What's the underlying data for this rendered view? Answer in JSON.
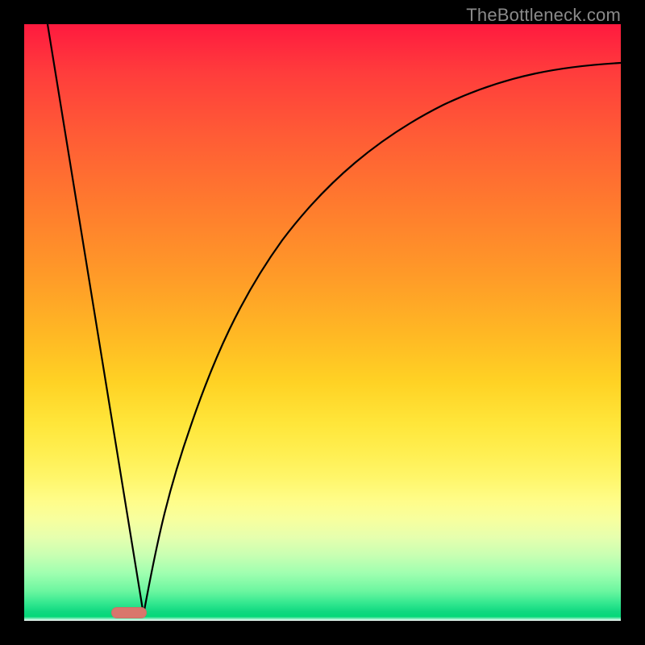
{
  "watermark": {
    "text": "TheBottleneck.com"
  },
  "colors": {
    "frame": "#000000",
    "marker": "#d9766c",
    "curve": "#000000",
    "gradient_stops": [
      "#ff1a3f",
      "#ff7a2e",
      "#ffd224",
      "#fffd8a",
      "#34e890",
      "#ffffff"
    ]
  },
  "chart_data": {
    "type": "line",
    "title": "",
    "xlabel": "",
    "ylabel": "",
    "xlim": [
      0,
      100
    ],
    "ylim": [
      0,
      100
    ],
    "legend": false,
    "grid": false,
    "marker": {
      "x_pct": 17,
      "width_pct": 6
    },
    "series": [
      {
        "name": "left_line",
        "x": [
          4.0,
          14.0,
          20.0
        ],
        "y": [
          100.0,
          35.0,
          0.8
        ]
      },
      {
        "name": "right_curve",
        "x": [
          20.0,
          24.0,
          28.0,
          33.5,
          40.0,
          48.0,
          58.0,
          70.0,
          84.0,
          100.0
        ],
        "y": [
          0.8,
          18.0,
          33.0,
          49.0,
          62.0,
          72.0,
          80.0,
          86.0,
          90.5,
          93.5
        ]
      }
    ]
  }
}
